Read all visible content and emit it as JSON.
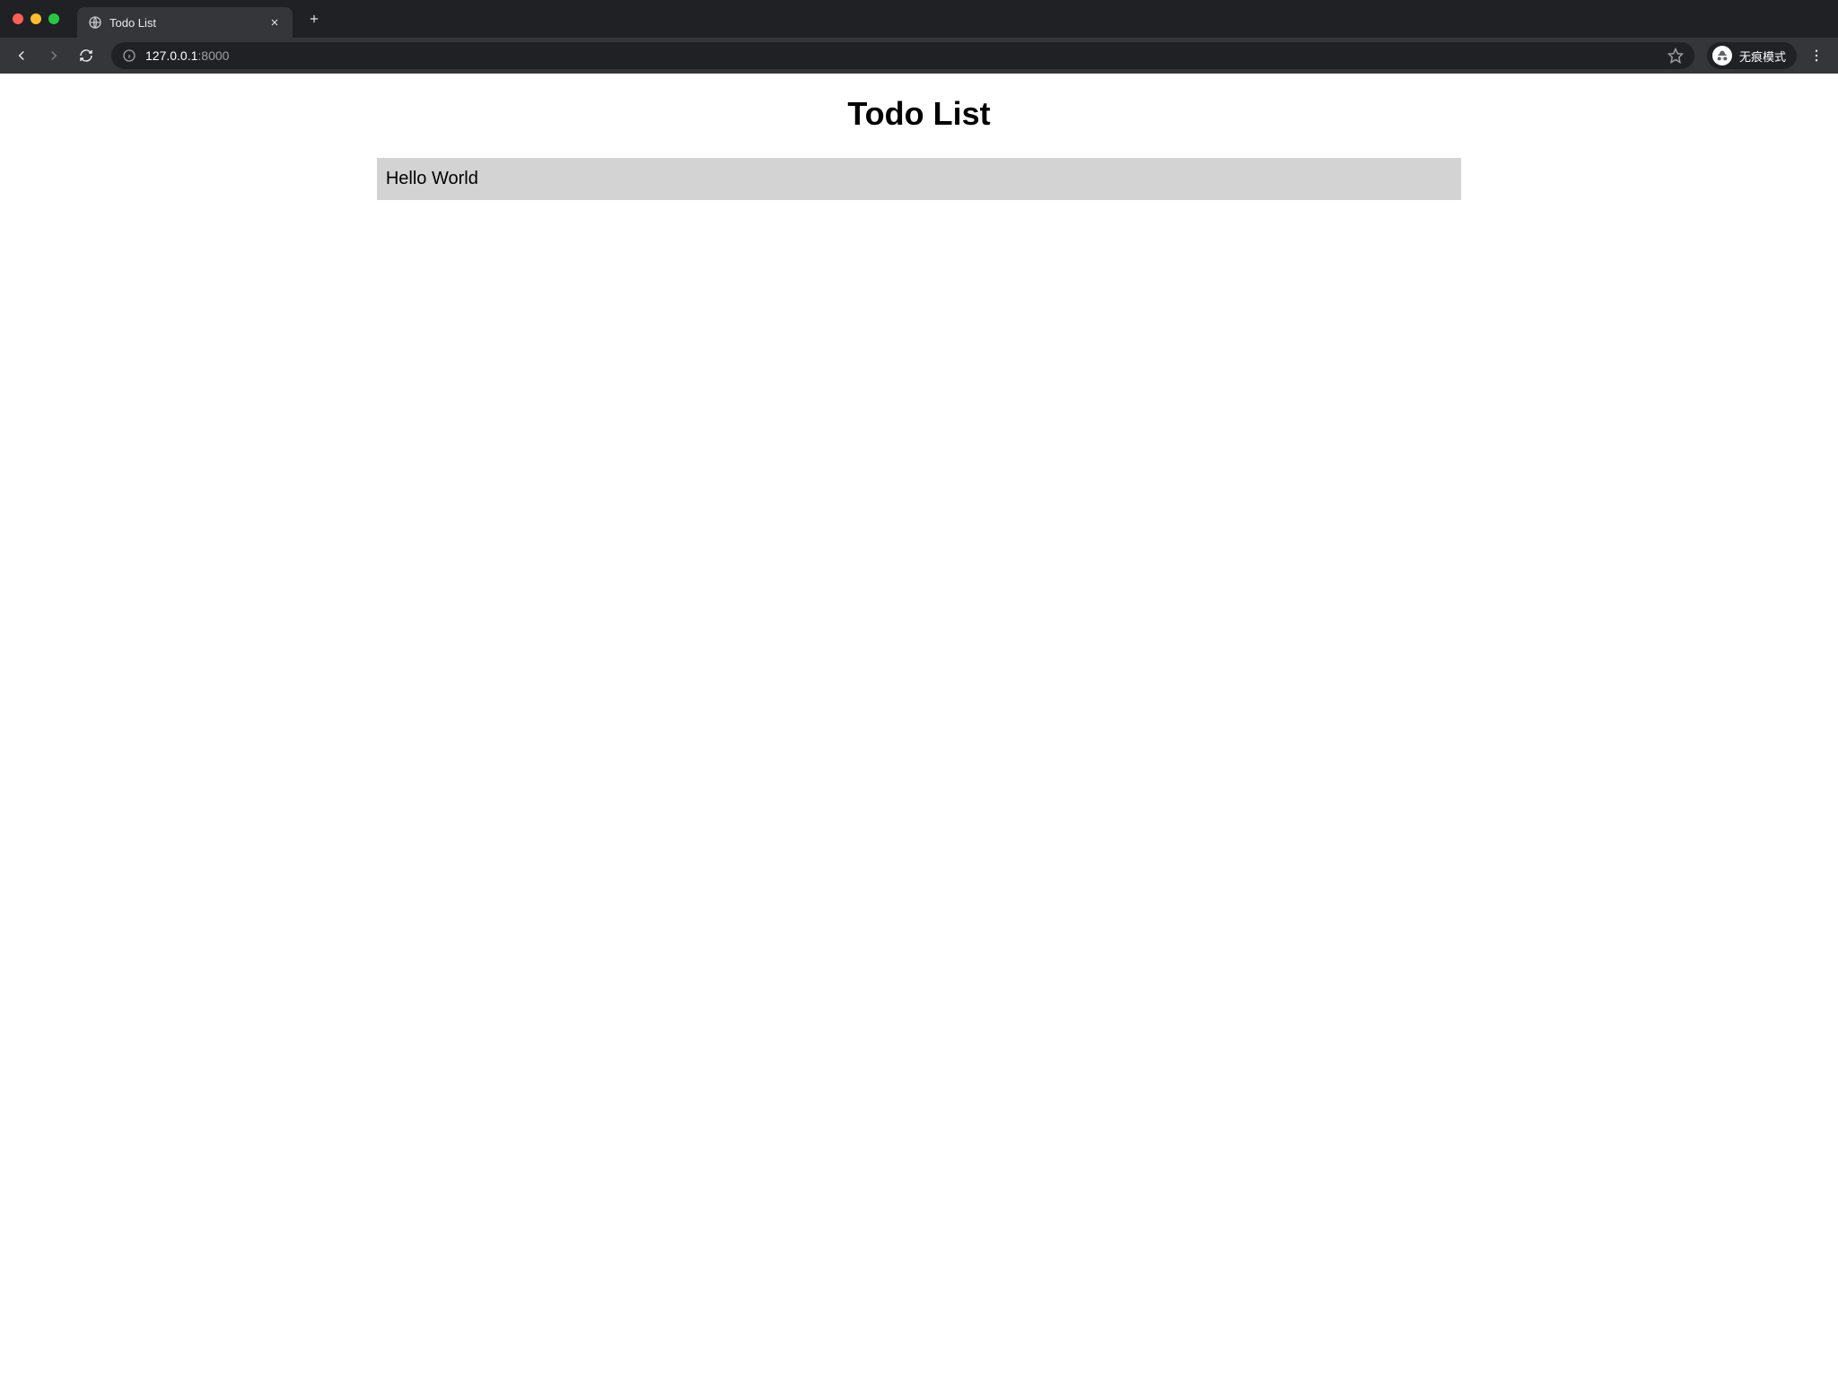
{
  "browser": {
    "tab_title": "Todo List",
    "url_host": "127.0.0.1",
    "url_port": ":8000",
    "incognito_label": "无痕模式"
  },
  "page": {
    "heading": "Todo List",
    "items": [
      "Hello World"
    ]
  }
}
